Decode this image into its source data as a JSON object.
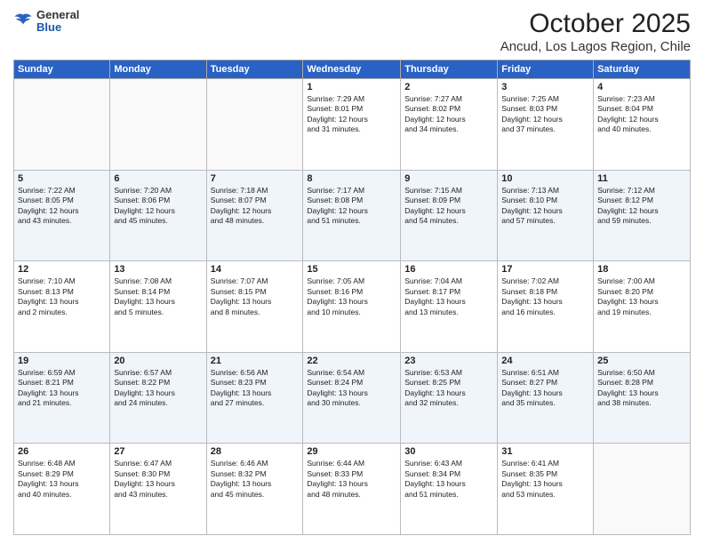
{
  "header": {
    "logo": {
      "general": "General",
      "blue": "Blue"
    },
    "month": "October 2025",
    "location": "Ancud, Los Lagos Region, Chile"
  },
  "days_of_week": [
    "Sunday",
    "Monday",
    "Tuesday",
    "Wednesday",
    "Thursday",
    "Friday",
    "Saturday"
  ],
  "rows": [
    [
      {
        "day": "",
        "lines": []
      },
      {
        "day": "",
        "lines": []
      },
      {
        "day": "",
        "lines": []
      },
      {
        "day": "1",
        "lines": [
          "Sunrise: 7:29 AM",
          "Sunset: 8:01 PM",
          "Daylight: 12 hours",
          "and 31 minutes."
        ]
      },
      {
        "day": "2",
        "lines": [
          "Sunrise: 7:27 AM",
          "Sunset: 8:02 PM",
          "Daylight: 12 hours",
          "and 34 minutes."
        ]
      },
      {
        "day": "3",
        "lines": [
          "Sunrise: 7:25 AM",
          "Sunset: 8:03 PM",
          "Daylight: 12 hours",
          "and 37 minutes."
        ]
      },
      {
        "day": "4",
        "lines": [
          "Sunrise: 7:23 AM",
          "Sunset: 8:04 PM",
          "Daylight: 12 hours",
          "and 40 minutes."
        ]
      }
    ],
    [
      {
        "day": "5",
        "lines": [
          "Sunrise: 7:22 AM",
          "Sunset: 8:05 PM",
          "Daylight: 12 hours",
          "and 43 minutes."
        ]
      },
      {
        "day": "6",
        "lines": [
          "Sunrise: 7:20 AM",
          "Sunset: 8:06 PM",
          "Daylight: 12 hours",
          "and 45 minutes."
        ]
      },
      {
        "day": "7",
        "lines": [
          "Sunrise: 7:18 AM",
          "Sunset: 8:07 PM",
          "Daylight: 12 hours",
          "and 48 minutes."
        ]
      },
      {
        "day": "8",
        "lines": [
          "Sunrise: 7:17 AM",
          "Sunset: 8:08 PM",
          "Daylight: 12 hours",
          "and 51 minutes."
        ]
      },
      {
        "day": "9",
        "lines": [
          "Sunrise: 7:15 AM",
          "Sunset: 8:09 PM",
          "Daylight: 12 hours",
          "and 54 minutes."
        ]
      },
      {
        "day": "10",
        "lines": [
          "Sunrise: 7:13 AM",
          "Sunset: 8:10 PM",
          "Daylight: 12 hours",
          "and 57 minutes."
        ]
      },
      {
        "day": "11",
        "lines": [
          "Sunrise: 7:12 AM",
          "Sunset: 8:12 PM",
          "Daylight: 12 hours",
          "and 59 minutes."
        ]
      }
    ],
    [
      {
        "day": "12",
        "lines": [
          "Sunrise: 7:10 AM",
          "Sunset: 8:13 PM",
          "Daylight: 13 hours",
          "and 2 minutes."
        ]
      },
      {
        "day": "13",
        "lines": [
          "Sunrise: 7:08 AM",
          "Sunset: 8:14 PM",
          "Daylight: 13 hours",
          "and 5 minutes."
        ]
      },
      {
        "day": "14",
        "lines": [
          "Sunrise: 7:07 AM",
          "Sunset: 8:15 PM",
          "Daylight: 13 hours",
          "and 8 minutes."
        ]
      },
      {
        "day": "15",
        "lines": [
          "Sunrise: 7:05 AM",
          "Sunset: 8:16 PM",
          "Daylight: 13 hours",
          "and 10 minutes."
        ]
      },
      {
        "day": "16",
        "lines": [
          "Sunrise: 7:04 AM",
          "Sunset: 8:17 PM",
          "Daylight: 13 hours",
          "and 13 minutes."
        ]
      },
      {
        "day": "17",
        "lines": [
          "Sunrise: 7:02 AM",
          "Sunset: 8:18 PM",
          "Daylight: 13 hours",
          "and 16 minutes."
        ]
      },
      {
        "day": "18",
        "lines": [
          "Sunrise: 7:00 AM",
          "Sunset: 8:20 PM",
          "Daylight: 13 hours",
          "and 19 minutes."
        ]
      }
    ],
    [
      {
        "day": "19",
        "lines": [
          "Sunrise: 6:59 AM",
          "Sunset: 8:21 PM",
          "Daylight: 13 hours",
          "and 21 minutes."
        ]
      },
      {
        "day": "20",
        "lines": [
          "Sunrise: 6:57 AM",
          "Sunset: 8:22 PM",
          "Daylight: 13 hours",
          "and 24 minutes."
        ]
      },
      {
        "day": "21",
        "lines": [
          "Sunrise: 6:56 AM",
          "Sunset: 8:23 PM",
          "Daylight: 13 hours",
          "and 27 minutes."
        ]
      },
      {
        "day": "22",
        "lines": [
          "Sunrise: 6:54 AM",
          "Sunset: 8:24 PM",
          "Daylight: 13 hours",
          "and 30 minutes."
        ]
      },
      {
        "day": "23",
        "lines": [
          "Sunrise: 6:53 AM",
          "Sunset: 8:25 PM",
          "Daylight: 13 hours",
          "and 32 minutes."
        ]
      },
      {
        "day": "24",
        "lines": [
          "Sunrise: 6:51 AM",
          "Sunset: 8:27 PM",
          "Daylight: 13 hours",
          "and 35 minutes."
        ]
      },
      {
        "day": "25",
        "lines": [
          "Sunrise: 6:50 AM",
          "Sunset: 8:28 PM",
          "Daylight: 13 hours",
          "and 38 minutes."
        ]
      }
    ],
    [
      {
        "day": "26",
        "lines": [
          "Sunrise: 6:48 AM",
          "Sunset: 8:29 PM",
          "Daylight: 13 hours",
          "and 40 minutes."
        ]
      },
      {
        "day": "27",
        "lines": [
          "Sunrise: 6:47 AM",
          "Sunset: 8:30 PM",
          "Daylight: 13 hours",
          "and 43 minutes."
        ]
      },
      {
        "day": "28",
        "lines": [
          "Sunrise: 6:46 AM",
          "Sunset: 8:32 PM",
          "Daylight: 13 hours",
          "and 45 minutes."
        ]
      },
      {
        "day": "29",
        "lines": [
          "Sunrise: 6:44 AM",
          "Sunset: 8:33 PM",
          "Daylight: 13 hours",
          "and 48 minutes."
        ]
      },
      {
        "day": "30",
        "lines": [
          "Sunrise: 6:43 AM",
          "Sunset: 8:34 PM",
          "Daylight: 13 hours",
          "and 51 minutes."
        ]
      },
      {
        "day": "31",
        "lines": [
          "Sunrise: 6:41 AM",
          "Sunset: 8:35 PM",
          "Daylight: 13 hours",
          "and 53 minutes."
        ]
      },
      {
        "day": "",
        "lines": []
      }
    ]
  ]
}
